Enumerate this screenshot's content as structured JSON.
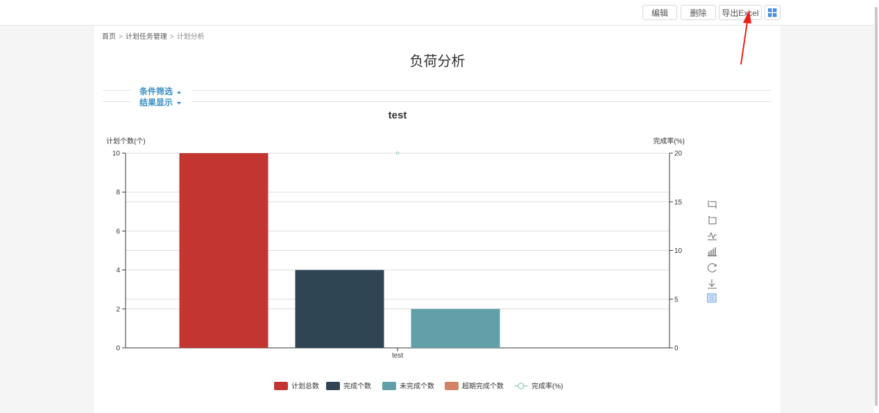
{
  "toolbar": {
    "edit_label": "编辑",
    "delete_label": "删除",
    "export_label": "导出Excel",
    "layout_icon": "grid-icon"
  },
  "breadcrumb": {
    "items": [
      "首页",
      "计划任务管理",
      "计划分析"
    ],
    "separator": ">"
  },
  "page": {
    "title": "负荷分析"
  },
  "filters": {
    "condition_label": "条件筛选",
    "result_label": "结果显示"
  },
  "toolbox_icons": [
    "zoom-icon",
    "zoom-reset-icon",
    "line-chart-icon",
    "bar-chart-icon",
    "restore-icon",
    "save-image-icon",
    "data-view-icon"
  ],
  "chart_data": {
    "type": "bar",
    "title": "test",
    "categories": [
      "test"
    ],
    "ylabel": "计划个数(个)",
    "ylim": [
      0,
      10
    ],
    "yticks": [
      0,
      2,
      4,
      6,
      8,
      10
    ],
    "y2label": "完成率(%)",
    "y2lim": [
      0,
      20
    ],
    "y2ticks": [
      0,
      5,
      10,
      15,
      20
    ],
    "grid": true,
    "legend_position": "bottom-center",
    "series": [
      {
        "name": "计划总数",
        "type": "bar",
        "values": [
          10
        ],
        "color": "#c23531"
      },
      {
        "name": "完成个数",
        "type": "bar",
        "values": [
          4
        ],
        "color": "#2f4554"
      },
      {
        "name": "未完成个数",
        "type": "bar",
        "values": [
          2
        ],
        "color": "#61a0a8"
      },
      {
        "name": "超期完成个数",
        "type": "bar",
        "values": [
          0
        ],
        "color": "#d48265"
      },
      {
        "name": "完成率(%)",
        "type": "line",
        "axis": "right",
        "values": [
          20
        ],
        "color": "#91c7ae"
      }
    ]
  }
}
